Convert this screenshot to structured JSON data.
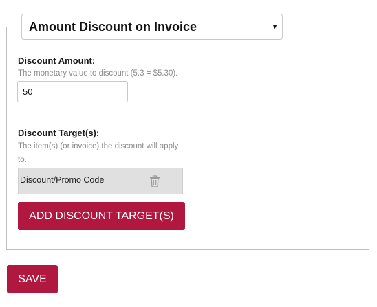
{
  "discount_type": {
    "selected": "Amount Discount on Invoice"
  },
  "discount_amount": {
    "label": "Discount Amount:",
    "help": "The monetary value to discount (5.3 = $5.30).",
    "value": "50"
  },
  "discount_targets": {
    "label": "Discount Target(s):",
    "help_line1": "The item(s) (or invoice) the discount will apply",
    "help_line2": "to.",
    "items": [
      {
        "label": "Discount/Promo Code",
        "remove_icon": "trash-icon"
      }
    ],
    "add_button_label": "ADD DISCOUNT TARGET(S)"
  },
  "save_button_label": "SAVE",
  "colors": {
    "primary": "#b0183f",
    "target_row_bg": "#e0e0e0",
    "help_text": "#8a8a8a"
  }
}
